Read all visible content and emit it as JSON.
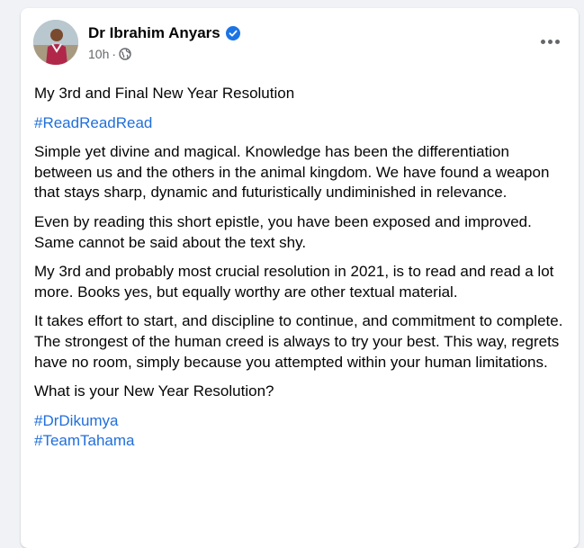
{
  "post": {
    "author": "Dr Ibrahim Anyars",
    "time": "10h",
    "dot": "·",
    "paragraphs": [
      "My 3rd and Final New Year Resolution",
      "Simple yet divine and magical. Knowledge has been the differentiation between us and the others in the animal kingdom. We have found a weapon that stays sharp, dynamic and futuristically undiminished in relevance.",
      "Even by reading this short epistle, you have been exposed and improved. Same cannot be said about the text shy.",
      "My 3rd and probably most crucial resolution in 2021, is to read and read a lot more. Books yes, but equally worthy are other textual material.",
      "It takes effort to start, and discipline to continue, and commitment to complete. The strongest of the human creed is always to try your best. This way, regrets have no room, simply because you attempted within your human limitations.",
      "What is your New Year Resolution?"
    ],
    "hashtag_top": "#ReadReadRead",
    "hashtags_bottom": [
      "#DrDikumya",
      "#TeamTahama"
    ]
  },
  "icons": {
    "verified": "verified-badge-icon",
    "privacy": "globe-icon",
    "menu": "more-options-icon"
  },
  "colors": {
    "link": "#216fdb",
    "verified": "#1b74e4",
    "meta": "#65676b",
    "background": "#f0f2f5"
  }
}
